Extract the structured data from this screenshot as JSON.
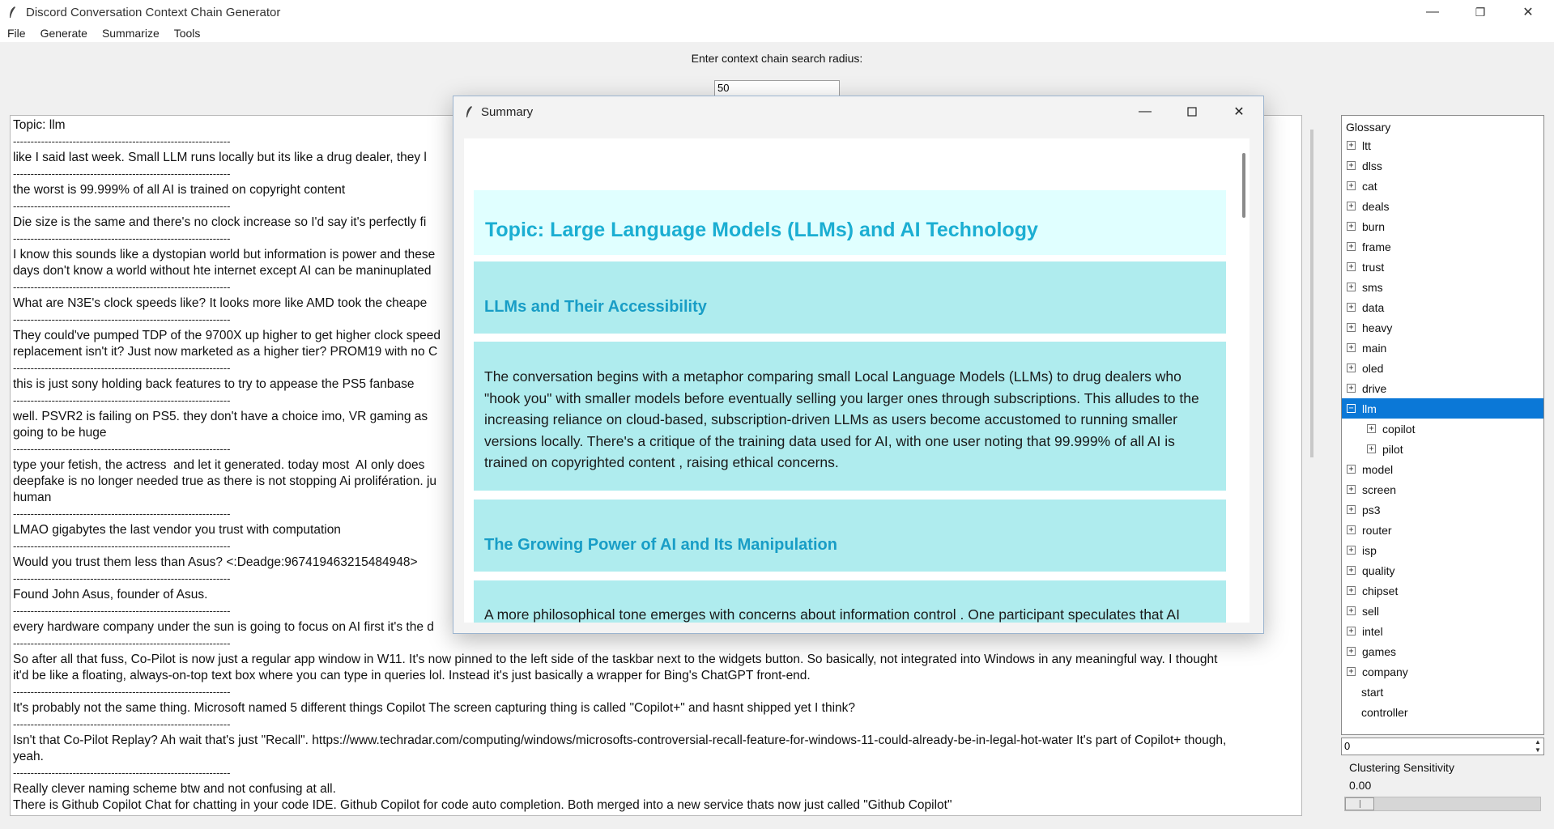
{
  "window": {
    "title": "Discord Conversation Context Chain Generator",
    "controls": {
      "minimize": "—",
      "restore": "❐",
      "close": "✕"
    }
  },
  "menu": [
    "File",
    "Generate",
    "Summarize",
    "Tools"
  ],
  "radius": {
    "label": "Enter context chain search radius:",
    "value": "50"
  },
  "chat": {
    "separator": "--------------------------------------------------------------",
    "entries": [
      "Topic: llm",
      "like I said last week. Small LLM runs locally but its like a drug dealer, they l",
      "the worst is 99.999% of all AI is trained on copyright content",
      "Die size is the same and there's no clock increase so I'd say it's perfectly fi                                                                                                                                           tion",
      "I know this sounds like a dystopian world but information is power and these                                                                                                                                         s\ndays don't know a world without hte internet except AI can be maninuplated",
      "What are N3E's clock speeds like? It looks more like AMD took the cheape",
      "They could've pumped TDP of the 9700X up higher to get higher clock speed\nreplacement isn't it? Just now marketed as a higher tier? PROM19 with no C",
      "this is just sony holding back features to try to appease the PS5 fanbase",
      "well. PSVR2 is failing on PS5. they don't have a choice imo, VR gaming as                                                                                                                                              s\ngoing to be huge",
      "type your fetish, the actress  and let it generated. today most  AI only does                                                                                                                                          e\ndeepfake is no longer needed true as there is not stopping Ai prolifération. ju                                                                                                                                     ost\nhuman",
      "LMAO gigabytes the last vendor you trust with computation",
      "Would you trust them less than Asus? <:Deadge:967419463215484948>",
      "Found John Asus, founder of Asus.",
      "every hardware company under the sun is going to focus on AI first it's the d",
      "So after all that fuss, Co-Pilot is now just a regular app window in W11. It's now pinned to the left side of the taskbar next to the widgets button. So basically, not integrated into Windows in any meaningful way. I thought\nit'd be like a floating, always-on-top text box where you can type in queries lol. Instead it's just basically a wrapper for Bing's ChatGPT front-end.",
      "It's probably not the same thing. Microsoft named 5 different things Copilot The screen capturing thing is called \"Copilot+\" and hasnt shipped yet I think?",
      "Isn't that Co-Pilot Replay? Ah wait that's just \"Recall\". https://www.techradar.com/computing/windows/microsofts-controversial-recall-feature-for-windows-11-could-already-be-in-legal-hot-water It's part of Copilot+ though,\nyeah.",
      "Really clever naming scheme btw and not confusing at all.\nThere is Github Copilot Chat for chatting in your code IDE. Github Copilot for code auto completion. Both merged into a new service thats now just called \"Github Copilot\""
    ]
  },
  "glossary": {
    "heading": "Glossary",
    "selected": "llm",
    "items": [
      {
        "label": "ltt",
        "kind": "root"
      },
      {
        "label": "dlss",
        "kind": "root"
      },
      {
        "label": "cat",
        "kind": "root"
      },
      {
        "label": "deals",
        "kind": "root"
      },
      {
        "label": "burn",
        "kind": "root"
      },
      {
        "label": "frame",
        "kind": "root"
      },
      {
        "label": "trust",
        "kind": "root"
      },
      {
        "label": "sms",
        "kind": "root"
      },
      {
        "label": "data",
        "kind": "root"
      },
      {
        "label": "heavy",
        "kind": "root"
      },
      {
        "label": "main",
        "kind": "root"
      },
      {
        "label": "oled",
        "kind": "root"
      },
      {
        "label": "drive",
        "kind": "root"
      },
      {
        "label": "llm",
        "kind": "expanded"
      },
      {
        "label": "copilot",
        "kind": "child"
      },
      {
        "label": "pilot",
        "kind": "child"
      },
      {
        "label": "model",
        "kind": "root"
      },
      {
        "label": "screen",
        "kind": "root"
      },
      {
        "label": "ps3",
        "kind": "root"
      },
      {
        "label": "router",
        "kind": "root"
      },
      {
        "label": "isp",
        "kind": "root"
      },
      {
        "label": "quality",
        "kind": "root"
      },
      {
        "label": "chipset",
        "kind": "root"
      },
      {
        "label": "sell",
        "kind": "root"
      },
      {
        "label": "intel",
        "kind": "root"
      },
      {
        "label": "games",
        "kind": "root"
      },
      {
        "label": "company",
        "kind": "root"
      },
      {
        "label": "start",
        "kind": "leaf"
      },
      {
        "label": "controller",
        "kind": "leaf"
      }
    ]
  },
  "spinbox": {
    "value": "0"
  },
  "clustering": {
    "label": "Clustering Sensitivity",
    "value": "0.00",
    "level": 0.0
  },
  "summary_dialog": {
    "title": "Summary",
    "topic": "Topic: Large Language Models (LLMs) and AI Technology",
    "sections": [
      {
        "heading": "LLMs and Their Accessibility",
        "body": "The conversation begins with a metaphor comparing small Local Language Models (LLMs) to drug dealers who \"hook you\" with smaller models before eventually selling you larger ones through subscriptions. This alludes to the increasing reliance on cloud-based, subscription-driven LLMs as users become accustomed to running smaller versions locally. There's a critique of the training data used for AI, with one user noting that 99.999% of all AI is trained on copyrighted content , raising ethical concerns."
      },
      {
        "heading": "The Growing Power of AI and Its Manipulation",
        "body": "A more philosophical tone emerges with concerns about information control . One participant speculates that AI"
      }
    ]
  }
}
